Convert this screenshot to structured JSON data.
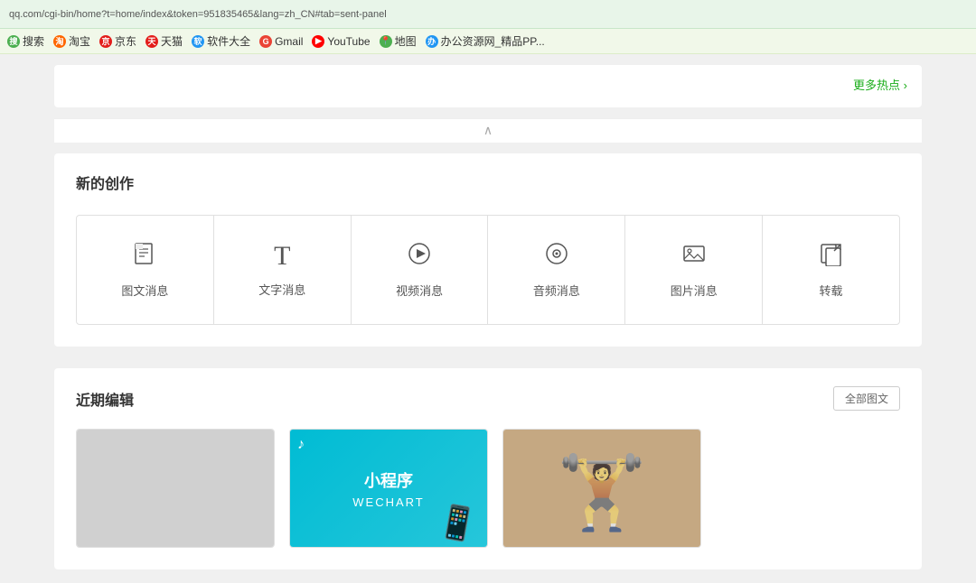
{
  "browser": {
    "url": "qq.com/cgi-bin/home?t=home/index&token=951835465&lang=zh_CN#tab=sent-panel"
  },
  "bookmarks": [
    {
      "label": "搜索",
      "iconClass": "icon-search",
      "iconText": "搜"
    },
    {
      "label": "淘宝",
      "iconClass": "icon-taobao",
      "iconText": "淘"
    },
    {
      "label": "京东",
      "iconClass": "icon-jd",
      "iconText": "京"
    },
    {
      "label": "天猫",
      "iconClass": "icon-tmall",
      "iconText": "天"
    },
    {
      "label": "软件大全",
      "iconClass": "icon-software",
      "iconText": "软"
    },
    {
      "label": "Gmail",
      "iconClass": "icon-gmail",
      "iconText": "G"
    },
    {
      "label": "YouTube",
      "iconClass": "icon-youtube",
      "iconText": "▶"
    },
    {
      "label": "地图",
      "iconClass": "icon-map",
      "iconText": "地"
    },
    {
      "label": "办公资源网_精品PP...",
      "iconClass": "icon-office",
      "iconText": "办"
    }
  ],
  "hotTopics": {
    "moreHotText": "更多热点 ›"
  },
  "creationSection": {
    "title": "新的创作",
    "items": [
      {
        "label": "图文消息",
        "icon": "📄",
        "iconType": "doc"
      },
      {
        "label": "文字消息",
        "icon": "T",
        "iconType": "text"
      },
      {
        "label": "视频消息",
        "icon": "▶",
        "iconType": "video"
      },
      {
        "label": "音频消息",
        "icon": "◉",
        "iconType": "audio"
      },
      {
        "label": "图片消息",
        "icon": "🖼",
        "iconType": "image"
      },
      {
        "label": "转载",
        "icon": "↗",
        "iconType": "share"
      }
    ]
  },
  "recentSection": {
    "title": "近期编辑",
    "viewAllLabel": "全部图文",
    "items": [
      {
        "type": "gray"
      },
      {
        "type": "teal",
        "title": "小程序",
        "subtitle": "WECHART"
      },
      {
        "type": "sport"
      }
    ]
  }
}
